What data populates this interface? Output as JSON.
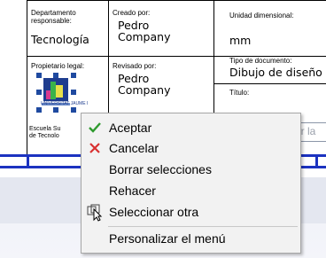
{
  "title_block": {
    "department_label": "Departamento responsable:",
    "department_value": "Tecnología",
    "created_by_label": "Creado por:",
    "created_by_value": "Pedro Company",
    "unit_label": "Unidad dimensional:",
    "unit_value": "mm",
    "owner_label": "Propietario legal:",
    "reviewed_by_label": "Revisado por:",
    "reviewed_by_value": "Pedro Company",
    "doc_type_label": "Tipo de documento:",
    "doc_type_value": "Dibujo de diseño",
    "title_label": "Título:",
    "title_field_partial": "ar la",
    "owner_value_line1": "Escuela Su",
    "owner_value_line2": "de Tecnolo",
    "logo_text": "UNIVERSITAT JAUME I"
  },
  "context_menu": {
    "items": [
      {
        "label": "Aceptar",
        "icon": "checkmark-icon",
        "color": "#2e9a2e"
      },
      {
        "label": "Cancelar",
        "icon": "red-x-icon",
        "color": "#d83030"
      },
      {
        "label": "Borrar selecciones",
        "icon": ""
      },
      {
        "label": "Rehacer",
        "icon": ""
      },
      {
        "label": "Seleccionar otra",
        "icon": "select-other-icon"
      },
      {
        "label": "Personalizar el menú",
        "icon": ""
      }
    ]
  },
  "colors": {
    "frame_blue": "#1c33c0",
    "menu_bg": "#f2f2f2"
  }
}
